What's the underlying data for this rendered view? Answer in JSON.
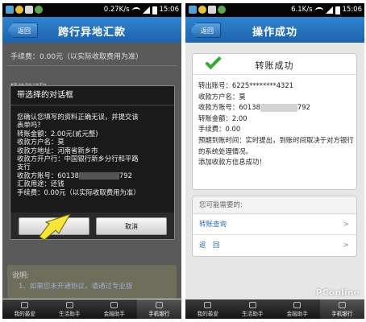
{
  "left": {
    "status": {
      "speed": "0.27K/s",
      "time": "15:06"
    },
    "back_label": "返回",
    "title": "跨行异地汇款",
    "fee_line": "手续费：0.00元（以实际收取费用为准）",
    "code_label": "短信验证码:",
    "dialog": {
      "title": "带选择的对话框",
      "lines": {
        "l1": "您确认您填写的资料正确无误，并提交该",
        "l2": "表单吗？",
        "l3": "转账金额：2.00元(贰元整)",
        "l4": "收款方户名：莫",
        "l5": "收款方地址：河南省新乡市",
        "l6": "收款方开户行：中国银行新乡分行和平路",
        "l7": "支行",
        "l8a": "收款方账号：60138",
        "l8b": "792",
        "l9": "汇款用途：还钱",
        "l10": "手续费：0.00元（以实际收取费用为准）"
      },
      "ok_label": "确定",
      "cancel_label": "取消"
    },
    "note_title": "说明:",
    "note_text": "1、如果您未开通协议，请通过专业版"
  },
  "right": {
    "status": {
      "speed": "6.1K/s",
      "time": "15:06"
    },
    "back_label": "返回",
    "title": "操作成功",
    "card_title": "转账成功",
    "details": {
      "out_account": "转出账号：6225********4321",
      "payee_name": "收款方户名：莫",
      "payee_account_a": "收款方账号：60138",
      "payee_account_b": "792",
      "amount": "转账金额：2.00",
      "fee": "手续费：0.00",
      "arrival": "预期到账时间：实时提出，到账时间取决于对方银行的系统处理情况。",
      "added": "添加收款方信息成功！"
    },
    "panel_title": "您可能需要的:",
    "links": [
      "转账查询",
      "返　回"
    ],
    "chevron": ">"
  },
  "tabs": [
    "我的最爱",
    "生活助手",
    "金融助手",
    "手机银行"
  ],
  "watermark": "PConline"
}
